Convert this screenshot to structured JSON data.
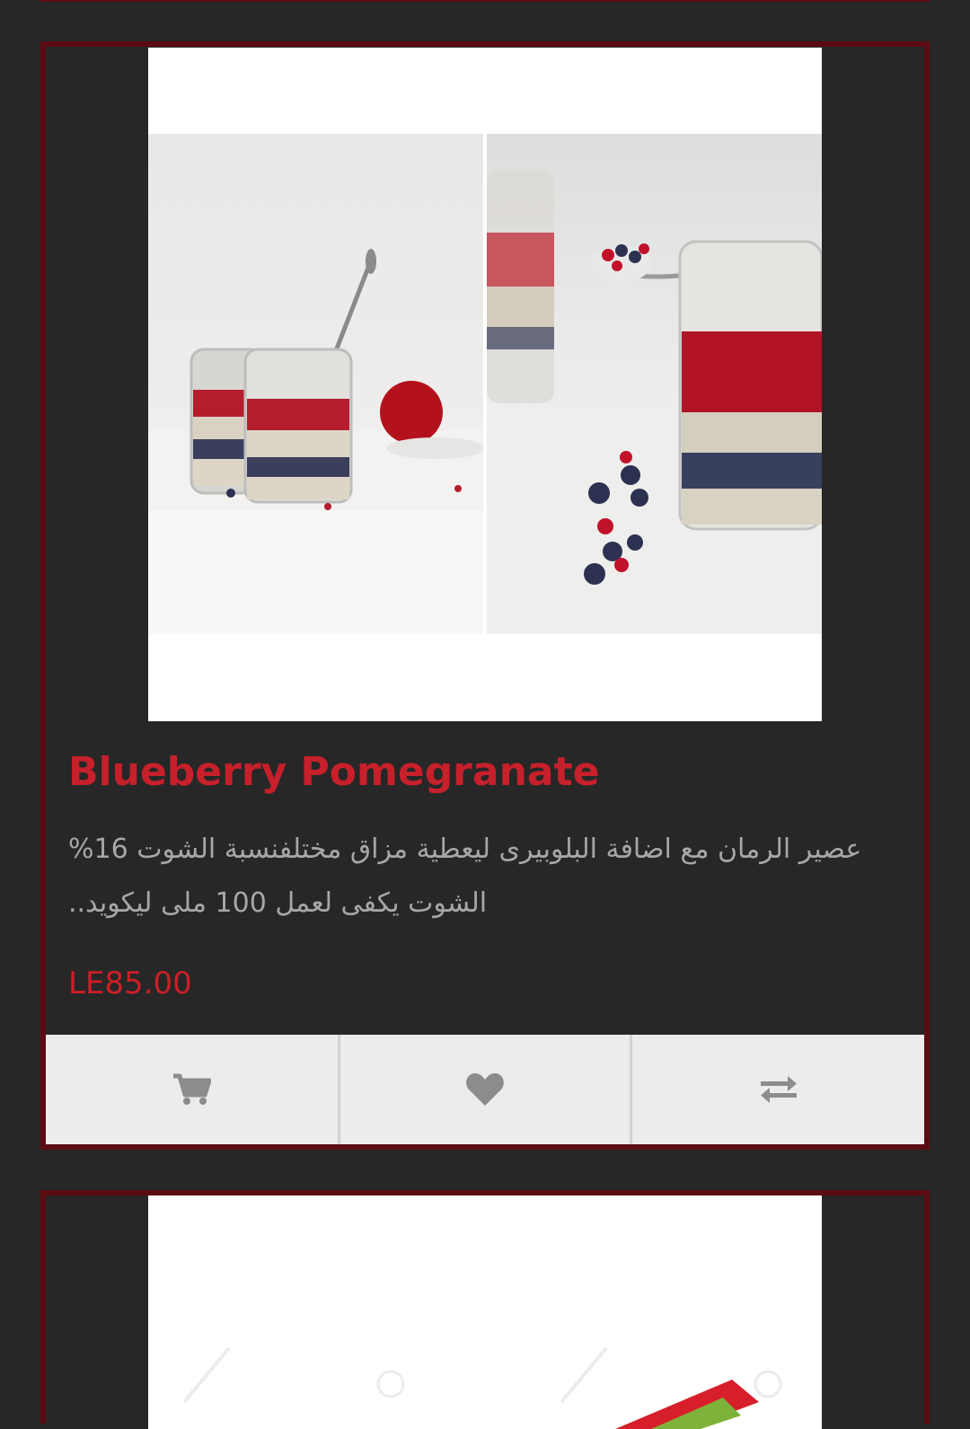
{
  "product": {
    "title": "Blueberry Pomegranate",
    "description": "عصير الرمان مع اضافة البلوبيرى ليعطية مزاق مختلفنسبة الشوت 16% الشوت يكفى لعمل 100 ملى ليكويد..",
    "price": "LE85.00"
  },
  "actions": {
    "cart_icon": "cart-icon",
    "wishlist_icon": "heart-icon",
    "compare_icon": "exchange-icon"
  },
  "colors": {
    "accent": "#c6202b",
    "card_border": "#5a0c12",
    "background": "#272727",
    "description_text": "#a7a7a7",
    "action_bar": "#ececec",
    "icon": "#8c8c8c"
  }
}
